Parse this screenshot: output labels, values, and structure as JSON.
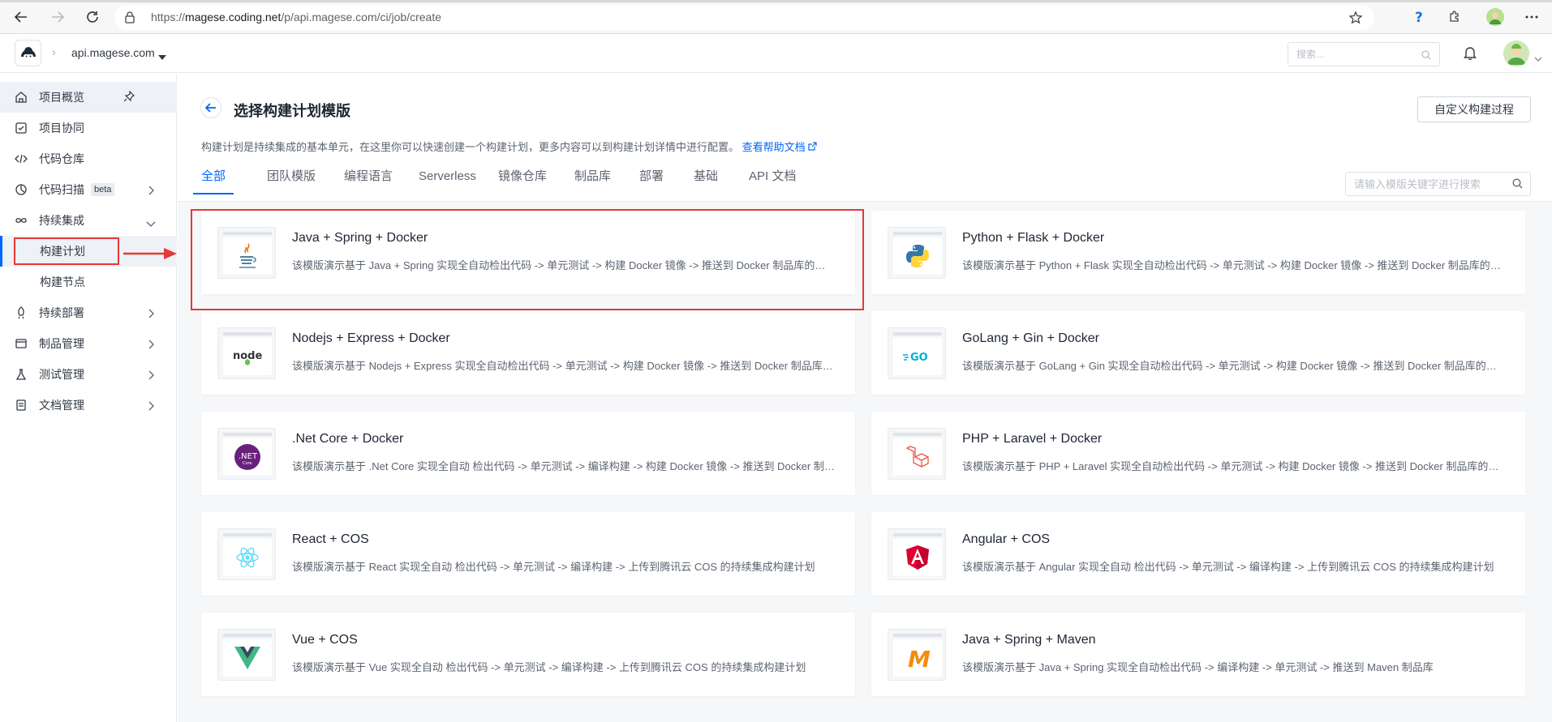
{
  "browser": {
    "url_prefix": "https://",
    "url_host": "magese.coding.net",
    "url_path": "/p/api.magese.com/ci/job/create"
  },
  "header": {
    "project_name": "api.magese.com",
    "search_placeholder": "搜索..."
  },
  "sidebar": {
    "items": [
      {
        "label": "项目概览",
        "icon": "home-icon"
      },
      {
        "label": "项目协同",
        "icon": "checkbox-icon"
      },
      {
        "label": "代码仓库",
        "icon": "code-icon"
      },
      {
        "label": "代码扫描",
        "icon": "scan-icon",
        "badge": "beta"
      },
      {
        "label": "持续集成",
        "icon": "infinity-icon"
      },
      {
        "label": "持续部署",
        "icon": "rocket-icon"
      },
      {
        "label": "制品管理",
        "icon": "box-icon"
      },
      {
        "label": "测试管理",
        "icon": "flask-icon"
      },
      {
        "label": "文档管理",
        "icon": "doc-icon"
      }
    ],
    "sub_items": [
      {
        "label": "构建计划"
      },
      {
        "label": "构建节点"
      }
    ]
  },
  "main": {
    "title": "选择构建计划模版",
    "custom_button": "自定义构建过程",
    "description": "构建计划是持续集成的基本单元，在这里你可以快速创建一个构建计划，更多内容可以到构建计划详情中进行配置。",
    "help_link": "查看帮助文档",
    "tabs": [
      "全部",
      "团队模版",
      "编程语言",
      "Serverless",
      "镜像仓库",
      "制品库",
      "部署",
      "基础",
      "API 文档"
    ],
    "template_search_placeholder": "请输入模版关键字进行搜索",
    "templates": [
      {
        "title": "Java + Spring + Docker",
        "desc": "该模版演示基于 Java + Spring 实现全自动检出代码 -> 单元测试 -> 构建 Docker 镜像 -> 推送到 Docker 制品库的持续集成构建计划",
        "icon": "java-icon"
      },
      {
        "title": "Python + Flask + Docker",
        "desc": "该模版演示基于 Python + Flask 实现全自动检出代码 -> 单元测试 -> 构建 Docker 镜像 -> 推送到 Docker 制品库的持续集成构建计划",
        "icon": "python-icon"
      },
      {
        "title": "Nodejs + Express + Docker",
        "desc": "该模版演示基于 Nodejs + Express 实现全自动检出代码 -> 单元测试 -> 构建 Docker 镜像 -> 推送到 Docker 制品库的持续集成构建计划",
        "icon": "nodejs-icon"
      },
      {
        "title": "GoLang + Gin + Docker",
        "desc": "该模版演示基于 GoLang + Gin 实现全自动检出代码 -> 单元测试 -> 构建 Docker 镜像 -> 推送到 Docker 制品库的持续集成构建计划",
        "icon": "golang-icon"
      },
      {
        "title": ".Net Core + Docker",
        "desc": "该模版演示基于 .Net Core 实现全自动 检出代码 -> 单元测试 -> 编译构建 -> 构建 Docker 镜像 -> 推送到 Docker 制品库的持续集成构建计划",
        "icon": "dotnet-icon"
      },
      {
        "title": "PHP + Laravel + Docker",
        "desc": "该模版演示基于 PHP + Laravel 实现全自动检出代码 -> 单元测试 -> 构建 Docker 镜像 -> 推送到 Docker 制品库的持续集成构建计划",
        "icon": "laravel-icon"
      },
      {
        "title": "React + COS",
        "desc": "该模版演示基于 React 实现全自动 检出代码 -> 单元测试 -> 编译构建 -> 上传到腾讯云 COS 的持续集成构建计划",
        "icon": "react-icon"
      },
      {
        "title": "Angular + COS",
        "desc": "该模版演示基于 Angular 实现全自动 检出代码 -> 单元测试 -> 编译构建 -> 上传到腾讯云 COS 的持续集成构建计划",
        "icon": "angular-icon"
      },
      {
        "title": "Vue + COS",
        "desc": "该模版演示基于 Vue 实现全自动 检出代码 -> 单元测试 -> 编译构建 -> 上传到腾讯云 COS 的持续集成构建计划",
        "icon": "vue-icon"
      },
      {
        "title": "Java + Spring + Maven",
        "desc": "该模版演示基于 Java + Spring 实现全自动检出代码 -> 编译构建 -> 单元测试 -> 推送到 Maven 制品库",
        "icon": "maven-icon"
      }
    ]
  },
  "colors": {
    "accent": "#0066ff",
    "highlight": "#e53935"
  }
}
